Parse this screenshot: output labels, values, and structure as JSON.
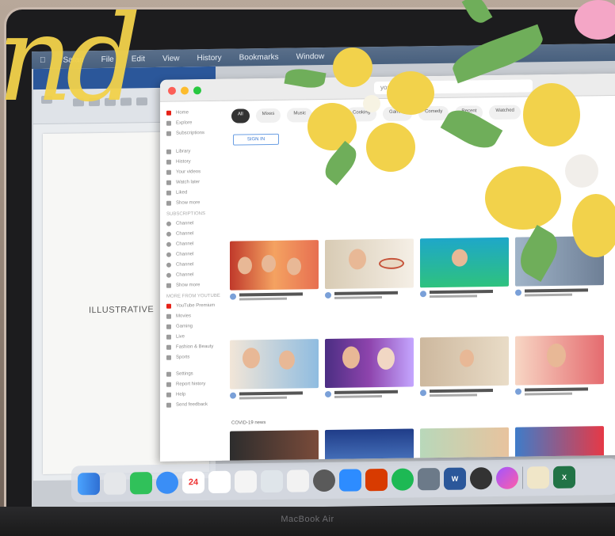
{
  "menubar": {
    "items": [
      "Safari",
      "File",
      "Edit",
      "View",
      "History",
      "Bookmarks",
      "Window"
    ]
  },
  "word": {
    "page_text": "ILLUSTRATIVE"
  },
  "browser": {
    "url": "youtube.com"
  },
  "youtube": {
    "sidebar_primary": [
      "Home",
      "Explore",
      "Subscriptions"
    ],
    "sidebar_secondary": [
      "Library",
      "History",
      "Your videos",
      "Watch later",
      "Liked",
      "Show more"
    ],
    "sidebar_heading_subs": "SUBSCRIPTIONS",
    "sidebar_subs": [
      "Channel",
      "Channel",
      "Channel",
      "Channel",
      "Channel",
      "Channel",
      "Show more"
    ],
    "sidebar_heading_more": "MORE FROM YOUTUBE",
    "sidebar_more": [
      "YouTube Premium",
      "Movies",
      "Gaming",
      "Live",
      "Fashion & Beauty",
      "Sports"
    ],
    "sidebar_settings": [
      "Settings",
      "Report history",
      "Help",
      "Send feedback"
    ],
    "chips": [
      "All",
      "Mixes",
      "Music",
      "Live",
      "Cooking",
      "Gaming",
      "Comedy",
      "Recent",
      "Watched"
    ],
    "signin_label": "SIGN IN",
    "section_covid": "COVID-19 news",
    "dock_calendar_day": "24",
    "dock_word_label": "W",
    "dock_excel_label": "X"
  },
  "laptop": {
    "brand": "MacBook Air"
  },
  "overlay": {
    "scribble_text": "nd"
  },
  "colors": {
    "yellow_accent": "#f2d24b",
    "leaf_green": "#6fae5a",
    "youtube_red": "#e62117"
  }
}
